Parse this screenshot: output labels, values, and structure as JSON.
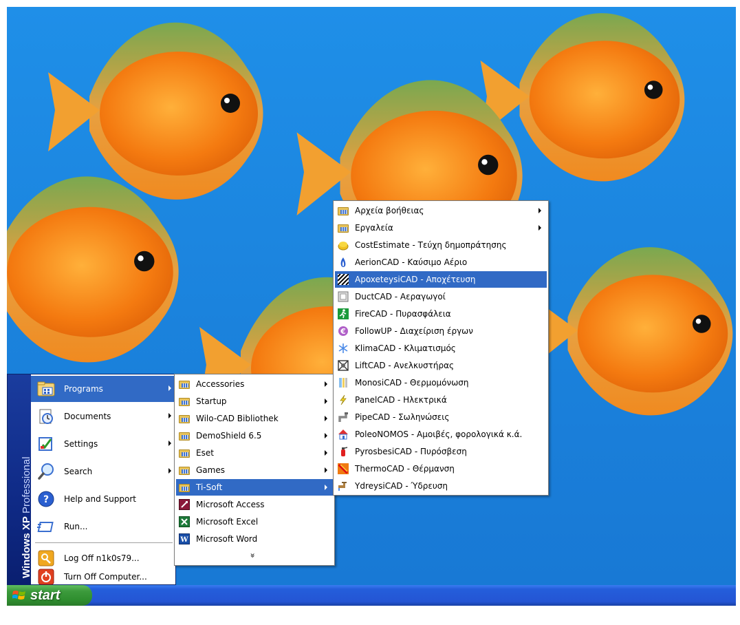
{
  "start_menu": {
    "side_text_bold": "Windows XP",
    "side_text_light": "Professional",
    "items": [
      {
        "label": "Programs",
        "icon": "programs-folder-icon",
        "submenu": true,
        "selected": true
      },
      {
        "label": "Documents",
        "icon": "documents-icon",
        "submenu": true
      },
      {
        "label": "Settings",
        "icon": "settings-icon",
        "submenu": true
      },
      {
        "label": "Search",
        "icon": "search-icon",
        "submenu": true
      },
      {
        "label": "Help and Support",
        "icon": "help-icon",
        "submenu": false
      },
      {
        "label": "Run...",
        "icon": "run-icon",
        "submenu": false
      },
      {
        "label": "Log Off n1k0s79...",
        "icon": "log-off-icon",
        "submenu": false
      },
      {
        "label": "Turn Off Computer...",
        "icon": "power-icon",
        "submenu": false
      }
    ]
  },
  "programs_menu": {
    "items": [
      {
        "label": "Accessories",
        "icon": "program-group-icon",
        "submenu": true
      },
      {
        "label": "Startup",
        "icon": "program-group-icon",
        "submenu": true
      },
      {
        "label": "Wilo-CAD Bibliothek",
        "icon": "program-group-icon",
        "submenu": true
      },
      {
        "label": "DemoShield 6.5",
        "icon": "program-group-icon",
        "submenu": true
      },
      {
        "label": "Eset",
        "icon": "program-group-icon",
        "submenu": true
      },
      {
        "label": "Games",
        "icon": "program-group-icon",
        "submenu": true
      },
      {
        "label": "Ti-Soft",
        "icon": "program-group-icon",
        "submenu": true,
        "selected": true
      },
      {
        "label": "Microsoft Access",
        "icon": "access-icon",
        "submenu": false
      },
      {
        "label": "Microsoft Excel",
        "icon": "excel-icon",
        "submenu": false
      },
      {
        "label": "Microsoft Word",
        "icon": "word-icon",
        "submenu": false
      }
    ],
    "more_glyph": "»"
  },
  "tisoft_menu": {
    "items": [
      {
        "label": "Αρχεία βοήθειας",
        "icon": "program-group-icon",
        "submenu": true
      },
      {
        "label": "Εργαλεία",
        "icon": "program-group-icon",
        "submenu": true
      },
      {
        "label": "CostEstimate - Τεύχη δημοπράτησης",
        "icon": "costestimate-icon"
      },
      {
        "label": "AerionCAD - Καύσιμο Αέριο",
        "icon": "flame-icon"
      },
      {
        "label": "ApoxeteysiCAD - Αποχέτευση",
        "icon": "drainage-icon",
        "selected": true
      },
      {
        "label": "DuctCAD - Αεραγωγοί",
        "icon": "duct-icon"
      },
      {
        "label": "FireCAD - Πυρασφάλεια",
        "icon": "fire-exit-icon"
      },
      {
        "label": "FollowUP - Διαχείριση έργων",
        "icon": "euro-icon"
      },
      {
        "label": "KlimaCAD - Κλιματισμός",
        "icon": "snowflake-icon"
      },
      {
        "label": "LiftCAD - Ανελκυστήρας",
        "icon": "lift-icon"
      },
      {
        "label": "MonosiCAD - Θερμομόνωση",
        "icon": "insulation-icon"
      },
      {
        "label": "PanelCAD - Ηλεκτρικά",
        "icon": "lightning-icon"
      },
      {
        "label": "PipeCAD - Σωληνώσεις",
        "icon": "pipe-icon"
      },
      {
        "label": "PoleoNOMOS - Αμοιβές, φορολογικά κ.ά.",
        "icon": "house-icon"
      },
      {
        "label": "PyrosbesiCAD - Πυρόσβεση",
        "icon": "extinguisher-icon"
      },
      {
        "label": "ThermoCAD - Θέρμανση",
        "icon": "heating-icon"
      },
      {
        "label": "YdreysiCAD - Ύδρευση",
        "icon": "faucet-icon"
      }
    ]
  },
  "taskbar": {
    "start_label": "start"
  },
  "colors": {
    "desktop": "#1b83dd",
    "selection": "#316ac5",
    "taskbar": "#245edb",
    "start_button": "#3c9a3c",
    "fish": "#f07a12"
  }
}
